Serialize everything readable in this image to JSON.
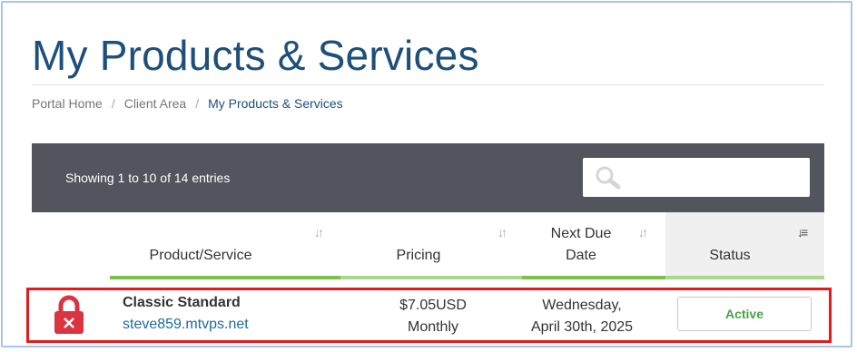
{
  "page": {
    "title": "My Products & Services"
  },
  "breadcrumb": {
    "items": [
      "Portal Home",
      "Client Area",
      "My Products & Services"
    ],
    "separator": "/"
  },
  "table": {
    "info": "Showing 1 to 10 of 14 entries",
    "search": {
      "placeholder": "",
      "value": "",
      "icon": "search-icon"
    },
    "columns": [
      {
        "label": "Product/Service",
        "sort": "unsorted"
      },
      {
        "label": "Pricing",
        "sort": "unsorted"
      },
      {
        "label": "Next Due Date",
        "line1": "Next Due",
        "line2": "Date",
        "sort": "unsorted"
      },
      {
        "label": "Status",
        "sort": "sorted-ascending"
      }
    ],
    "rows": [
      {
        "icon": "lock-suspended-icon",
        "name": "Classic Standard",
        "domain": "steve859.mtvps.net",
        "price": "$7.05USD",
        "cycle": "Monthly",
        "due_line1": "Wednesday,",
        "due_line2": "April 30th, 2025",
        "status": "Active"
      }
    ]
  },
  "colors": {
    "title": "#1e4f7a",
    "toolbar": "#52545e",
    "status_active": "#46a546",
    "highlight": "#e31b1b",
    "lock": "#d9343f"
  }
}
